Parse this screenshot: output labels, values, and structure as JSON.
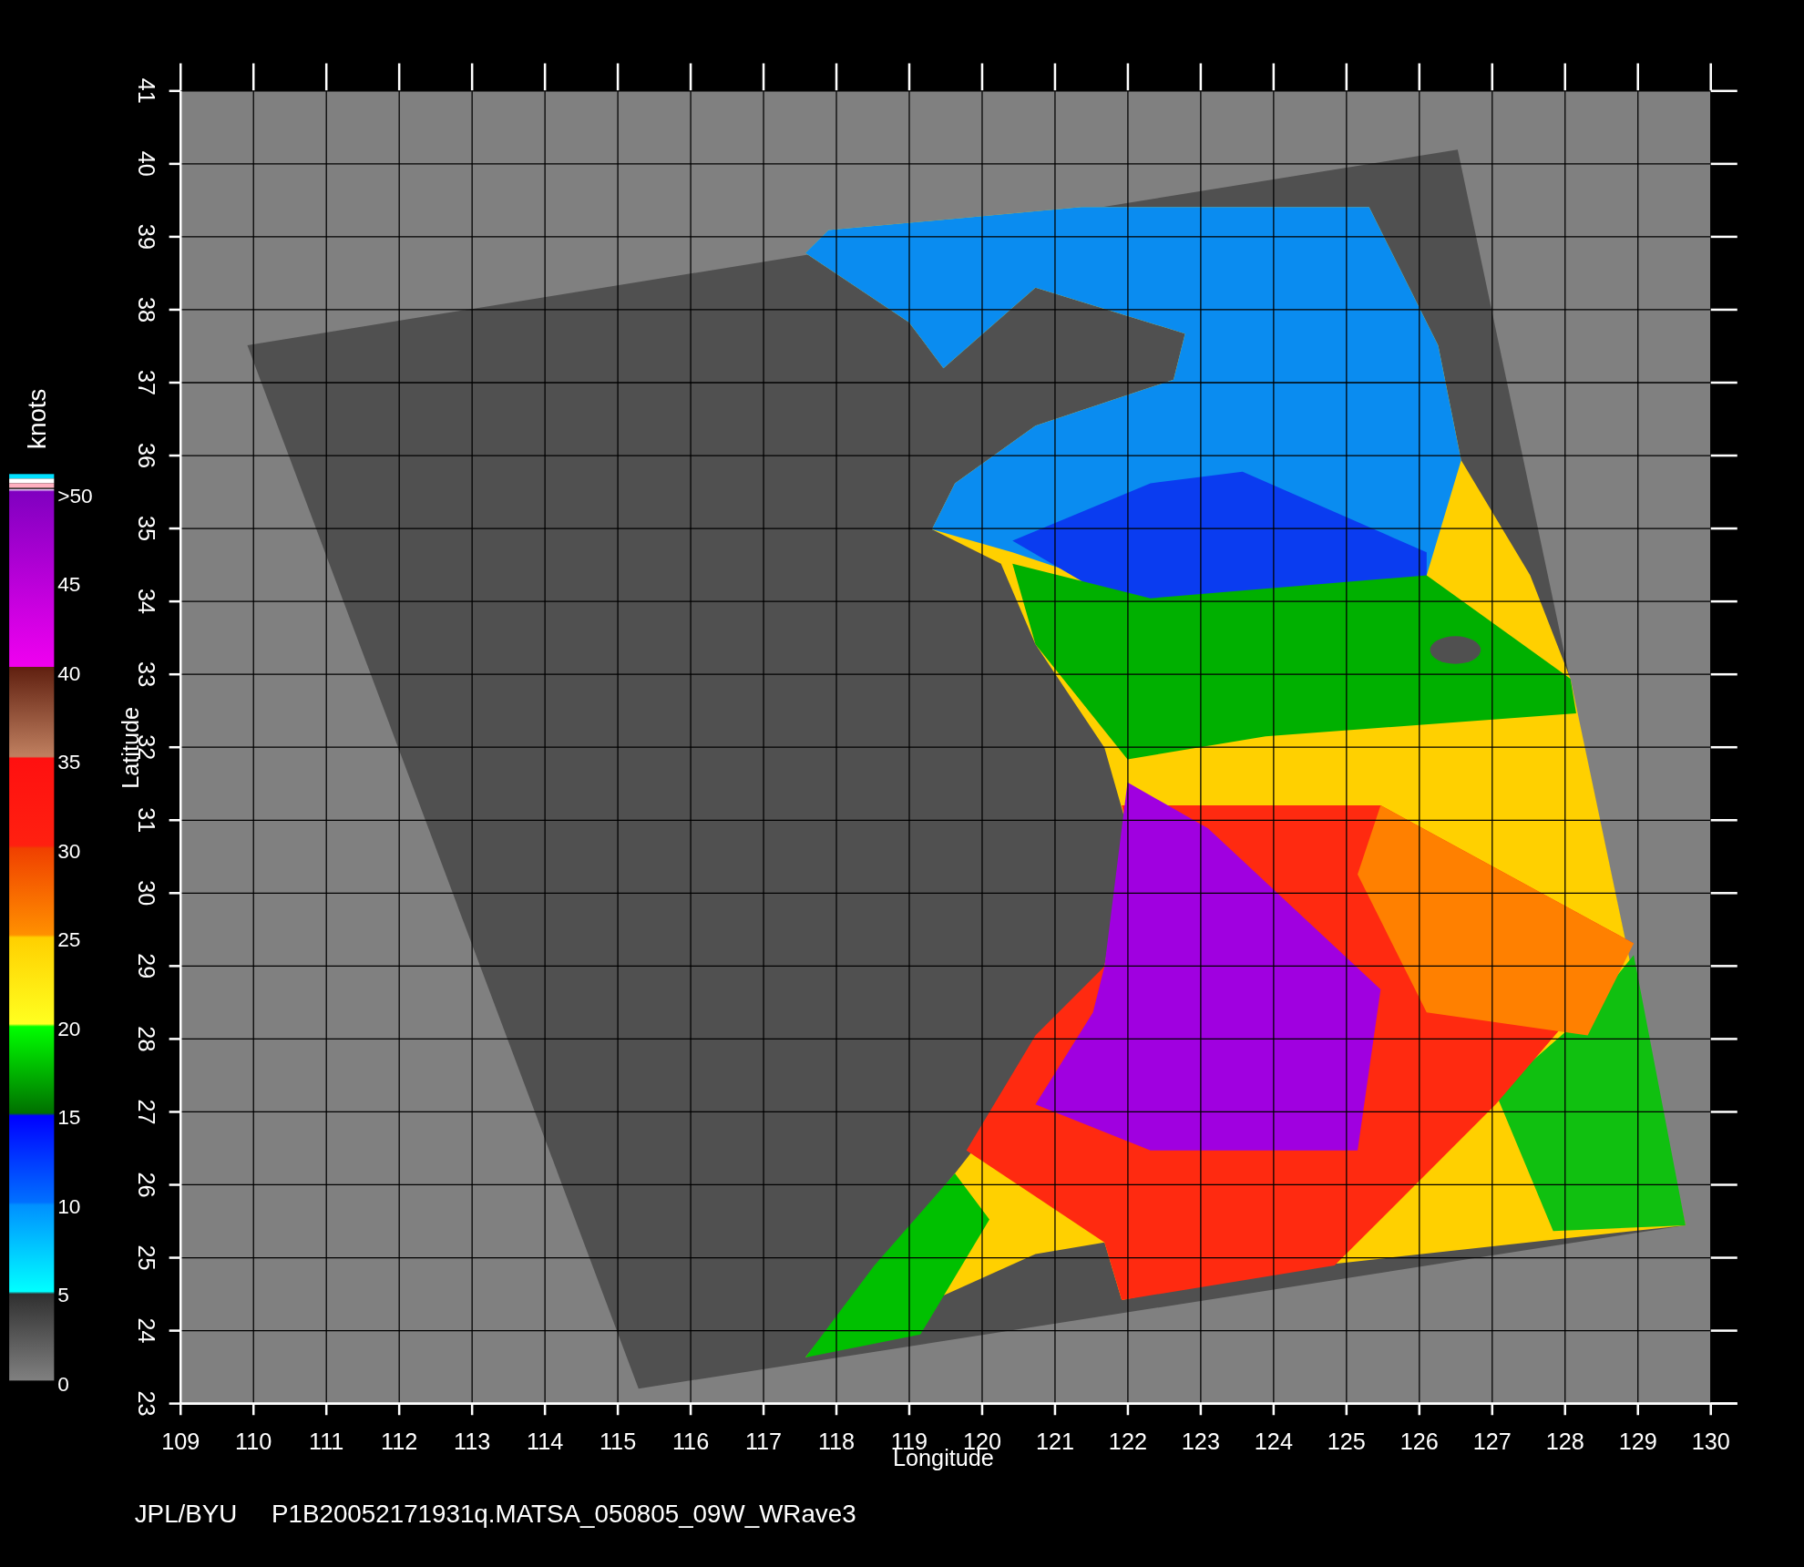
{
  "colorbar": {
    "unit": "knots",
    "labels": [
      ">50",
      "45",
      "40",
      "35",
      "30",
      "25",
      "20",
      "15",
      "10",
      "5",
      "0"
    ]
  },
  "map": {
    "x_axis": {
      "title": "Longitude",
      "ticks": [
        "109",
        "110",
        "111",
        "112",
        "113",
        "114",
        "115",
        "116",
        "117",
        "118",
        "119",
        "120",
        "121",
        "122",
        "123",
        "124",
        "125",
        "126",
        "127",
        "128",
        "129",
        "130"
      ]
    },
    "y_axis": {
      "title": "Latitude",
      "ticks": [
        "23",
        "24",
        "25",
        "26",
        "27",
        "28",
        "29",
        "30",
        "31",
        "32",
        "33",
        "34",
        "35",
        "36",
        "37",
        "38",
        "39",
        "40",
        "41"
      ]
    }
  },
  "caption": {
    "source": "JPL/BYU",
    "file": "P1B20052171931q.MATSA_050805_09W_WRave3"
  }
}
